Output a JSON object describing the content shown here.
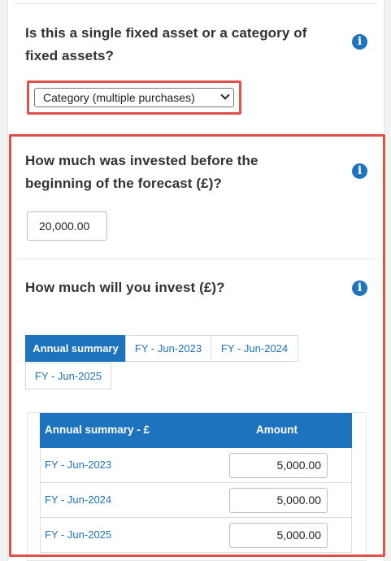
{
  "asset_type": {
    "question_line1": "Is this a single fixed asset or a category of",
    "question_line2": "fixed assets?",
    "selected": "Category (multiple purchases)"
  },
  "prior_investment": {
    "question_line1": "How much was invested before the",
    "question_line2": "beginning of the forecast (£)?",
    "value": "20,000.00"
  },
  "future_investment": {
    "question": "How much will you invest (£)?",
    "tabs": [
      {
        "label": "Annual summary"
      },
      {
        "label": "FY - Jun-2023"
      },
      {
        "label": "FY - Jun-2024"
      },
      {
        "label": "FY - Jun-2025"
      }
    ],
    "table": {
      "col1": "Annual summary - £",
      "col2": "Amount",
      "rows": [
        {
          "label": "FY - Jun-2023",
          "amount": "5,000.00"
        },
        {
          "label": "FY - Jun-2024",
          "amount": "5,000.00"
        },
        {
          "label": "FY - Jun-2025",
          "amount": "5,000.00"
        }
      ]
    }
  },
  "icons": {
    "info": "i"
  },
  "colors": {
    "accent": "#1e73be",
    "highlight": "#e0504a"
  }
}
